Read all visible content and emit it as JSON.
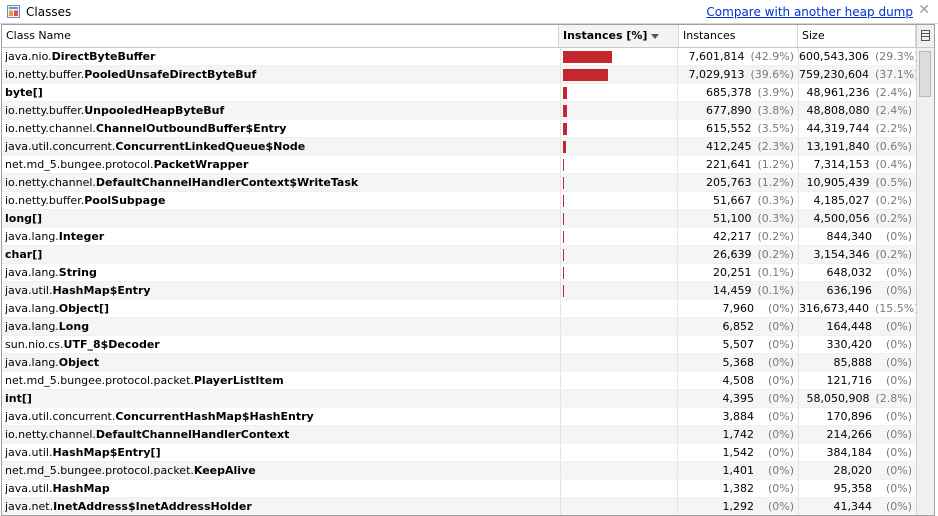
{
  "tab": {
    "title": "Classes",
    "icon": "classes-icon",
    "close": "✕"
  },
  "compare_link": "Compare with another heap dump",
  "columns": {
    "class_name": "Class Name",
    "instances_pct": "Instances [%]",
    "instances": "Instances",
    "size": "Size"
  },
  "bar_color": "#c4282e",
  "rows": [
    {
      "pkg": "java.nio.",
      "cls": "DirectByteBuffer",
      "instances": "7,601,814",
      "inst_pct": "(42.9%)",
      "size": "600,543,306",
      "size_pct": "(29.3%)",
      "pct": 42.9
    },
    {
      "pkg": "io.netty.buffer.",
      "cls": "PooledUnsafeDirectByteBuf",
      "instances": "7,029,913",
      "inst_pct": "(39.6%)",
      "size": "759,230,604",
      "size_pct": "(37.1%)",
      "pct": 39.6
    },
    {
      "pkg": "",
      "cls": "byte[]",
      "instances": "685,378",
      "inst_pct": "(3.9%)",
      "size": "48,961,236",
      "size_pct": "(2.4%)",
      "pct": 3.9
    },
    {
      "pkg": "io.netty.buffer.",
      "cls": "UnpooledHeapByteBuf",
      "instances": "677,890",
      "inst_pct": "(3.8%)",
      "size": "48,808,080",
      "size_pct": "(2.4%)",
      "pct": 3.8
    },
    {
      "pkg": "io.netty.channel.",
      "cls": "ChannelOutboundBuffer$Entry",
      "instances": "615,552",
      "inst_pct": "(3.5%)",
      "size": "44,319,744",
      "size_pct": "(2.2%)",
      "pct": 3.5
    },
    {
      "pkg": "java.util.concurrent.",
      "cls": "ConcurrentLinkedQueue$Node",
      "instances": "412,245",
      "inst_pct": "(2.3%)",
      "size": "13,191,840",
      "size_pct": "(0.6%)",
      "pct": 2.3
    },
    {
      "pkg": "net.md_5.bungee.protocol.",
      "cls": "PacketWrapper",
      "instances": "221,641",
      "inst_pct": "(1.2%)",
      "size": "7,314,153",
      "size_pct": "(0.4%)",
      "pct": 1.2
    },
    {
      "pkg": "io.netty.channel.",
      "cls": "DefaultChannelHandlerContext$WriteTask",
      "instances": "205,763",
      "inst_pct": "(1.2%)",
      "size": "10,905,439",
      "size_pct": "(0.5%)",
      "pct": 1.2
    },
    {
      "pkg": "io.netty.buffer.",
      "cls": "PoolSubpage",
      "instances": "51,667",
      "inst_pct": "(0.3%)",
      "size": "4,185,027",
      "size_pct": "(0.2%)",
      "pct": 0.3
    },
    {
      "pkg": "",
      "cls": "long[]",
      "instances": "51,100",
      "inst_pct": "(0.3%)",
      "size": "4,500,056",
      "size_pct": "(0.2%)",
      "pct": 0.3
    },
    {
      "pkg": "java.lang.",
      "cls": "Integer",
      "instances": "42,217",
      "inst_pct": "(0.2%)",
      "size": "844,340",
      "size_pct": "(0%)",
      "pct": 0.2
    },
    {
      "pkg": "",
      "cls": "char[]",
      "instances": "26,639",
      "inst_pct": "(0.2%)",
      "size": "3,154,346",
      "size_pct": "(0.2%)",
      "pct": 0.2
    },
    {
      "pkg": "java.lang.",
      "cls": "String",
      "instances": "20,251",
      "inst_pct": "(0.1%)",
      "size": "648,032",
      "size_pct": "(0%)",
      "pct": 0.1
    },
    {
      "pkg": "java.util.",
      "cls": "HashMap$Entry",
      "instances": "14,459",
      "inst_pct": "(0.1%)",
      "size": "636,196",
      "size_pct": "(0%)",
      "pct": 0.1
    },
    {
      "pkg": "java.lang.",
      "cls": "Object[]",
      "instances": "7,960",
      "inst_pct": "(0%)",
      "size": "316,673,440",
      "size_pct": "(15.5%)",
      "pct": 0
    },
    {
      "pkg": "java.lang.",
      "cls": "Long",
      "instances": "6,852",
      "inst_pct": "(0%)",
      "size": "164,448",
      "size_pct": "(0%)",
      "pct": 0
    },
    {
      "pkg": "sun.nio.cs.",
      "cls": "UTF_8$Decoder",
      "instances": "5,507",
      "inst_pct": "(0%)",
      "size": "330,420",
      "size_pct": "(0%)",
      "pct": 0
    },
    {
      "pkg": "java.lang.",
      "cls": "Object",
      "instances": "5,368",
      "inst_pct": "(0%)",
      "size": "85,888",
      "size_pct": "(0%)",
      "pct": 0
    },
    {
      "pkg": "net.md_5.bungee.protocol.packet.",
      "cls": "PlayerListItem",
      "instances": "4,508",
      "inst_pct": "(0%)",
      "size": "121,716",
      "size_pct": "(0%)",
      "pct": 0
    },
    {
      "pkg": "",
      "cls": "int[]",
      "instances": "4,395",
      "inst_pct": "(0%)",
      "size": "58,050,908",
      "size_pct": "(2.8%)",
      "pct": 0
    },
    {
      "pkg": "java.util.concurrent.",
      "cls": "ConcurrentHashMap$HashEntry",
      "instances": "3,884",
      "inst_pct": "(0%)",
      "size": "170,896",
      "size_pct": "(0%)",
      "pct": 0
    },
    {
      "pkg": "io.netty.channel.",
      "cls": "DefaultChannelHandlerContext",
      "instances": "1,742",
      "inst_pct": "(0%)",
      "size": "214,266",
      "size_pct": "(0%)",
      "pct": 0
    },
    {
      "pkg": "java.util.",
      "cls": "HashMap$Entry[]",
      "instances": "1,542",
      "inst_pct": "(0%)",
      "size": "384,184",
      "size_pct": "(0%)",
      "pct": 0
    },
    {
      "pkg": "net.md_5.bungee.protocol.packet.",
      "cls": "KeepAlive",
      "instances": "1,401",
      "inst_pct": "(0%)",
      "size": "28,020",
      "size_pct": "(0%)",
      "pct": 0
    },
    {
      "pkg": "java.util.",
      "cls": "HashMap",
      "instances": "1,382",
      "inst_pct": "(0%)",
      "size": "95,358",
      "size_pct": "(0%)",
      "pct": 0
    },
    {
      "pkg": "java.net.",
      "cls": "InetAddress$InetAddressHolder",
      "instances": "1,292",
      "inst_pct": "(0%)",
      "size": "41,344",
      "size_pct": "(0%)",
      "pct": 0
    }
  ]
}
